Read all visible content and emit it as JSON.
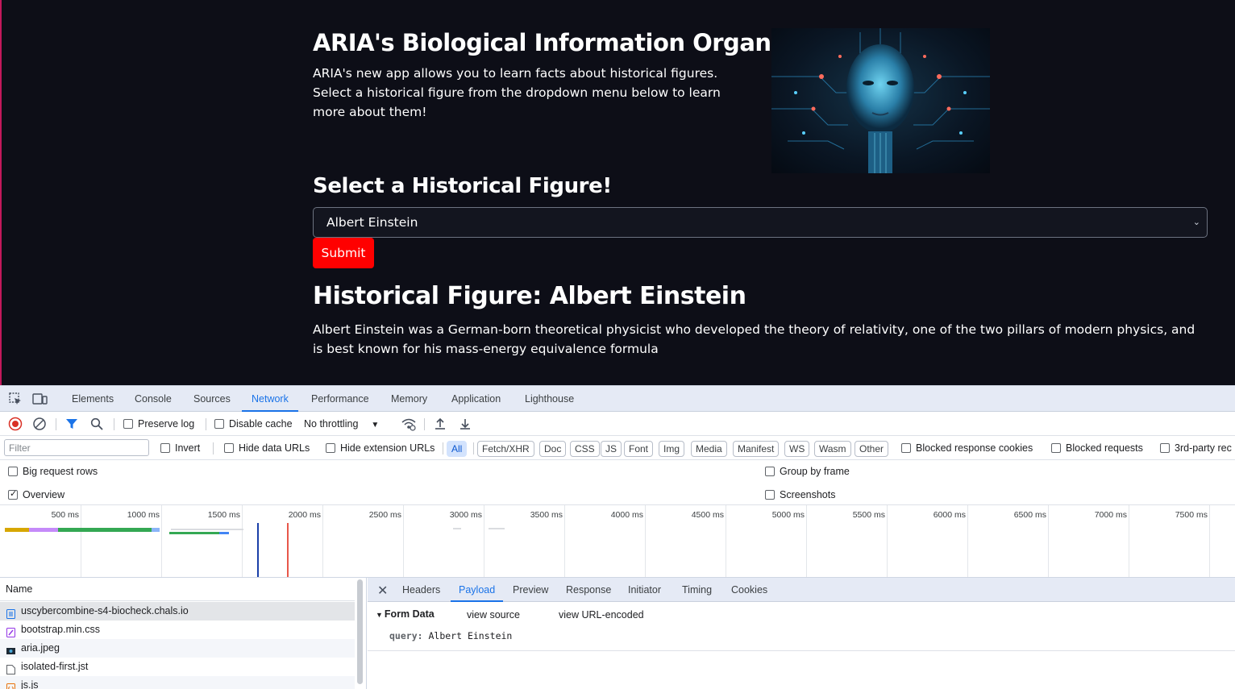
{
  "webpage": {
    "title": "ARIA's Biological Information Organizer",
    "intro": "ARIA's new app allows you to learn facts about historical figures. Select a historical figure from the dropdown menu below to learn more about them!",
    "select_heading": "Select a Historical Figure!",
    "selected_figure": "Albert Einstein",
    "submit_label": "Submit",
    "result_title": "Historical Figure: Albert Einstein",
    "result_body": "Albert Einstein was a German-born theoretical physicist who developed the theory of relativity, one of the two pillars of modern physics, and is best known for his mass-energy equivalence formula",
    "colors": {
      "background": "#0d0e17",
      "submit": "#ff0000"
    }
  },
  "devtools": {
    "tabs": [
      "Elements",
      "Console",
      "Sources",
      "Network",
      "Performance",
      "Memory",
      "Application",
      "Lighthouse"
    ],
    "active_tab": "Network",
    "toolbar": {
      "preserve_log": "Preserve log",
      "disable_cache": "Disable cache",
      "throttling": "No throttling"
    },
    "filter": {
      "placeholder": "Filter",
      "invert": "Invert",
      "hide_data_urls": "Hide data URLs",
      "hide_extension_urls": "Hide extension URLs",
      "types": [
        "All",
        "Fetch/XHR",
        "Doc",
        "CSS",
        "JS",
        "Font",
        "Img",
        "Media",
        "Manifest",
        "WS",
        "Wasm",
        "Other"
      ],
      "active_type": "All",
      "blocked_response_cookies": "Blocked response cookies",
      "blocked_requests": "Blocked requests",
      "third_party": "3rd-party rec"
    },
    "options": {
      "big_request_rows": "Big request rows",
      "group_by_frame": "Group by frame",
      "overview": "Overview",
      "overview_checked": true,
      "screenshots": "Screenshots"
    },
    "timeline_ticks": [
      "500 ms",
      "1000 ms",
      "1500 ms",
      "2000 ms",
      "2500 ms",
      "3000 ms",
      "3500 ms",
      "4000 ms",
      "4500 ms",
      "5000 ms",
      "5500 ms",
      "6000 ms",
      "6500 ms",
      "7000 ms",
      "7500 ms"
    ],
    "name_header": "Name",
    "requests": [
      {
        "name": "uscybercombine-s4-biocheck.chals.io",
        "type": "doc",
        "color": "#1a73e8"
      },
      {
        "name": "bootstrap.min.css",
        "type": "css",
        "color": "#9334e6"
      },
      {
        "name": "aria.jpeg",
        "type": "img",
        "color": "#1e2a36"
      },
      {
        "name": "isolated-first.jst",
        "type": "other",
        "color": "#5f6368"
      },
      {
        "name": "js.js",
        "type": "script",
        "color": "#e8710a"
      }
    ],
    "detail_tabs": [
      "Headers",
      "Payload",
      "Preview",
      "Response",
      "Initiator",
      "Timing",
      "Cookies"
    ],
    "detail_active": "Payload",
    "payload": {
      "section": "Form Data",
      "view_source": "view source",
      "view_url_encoded": "view URL-encoded",
      "key": "query:",
      "value": "Albert Einstein"
    }
  }
}
